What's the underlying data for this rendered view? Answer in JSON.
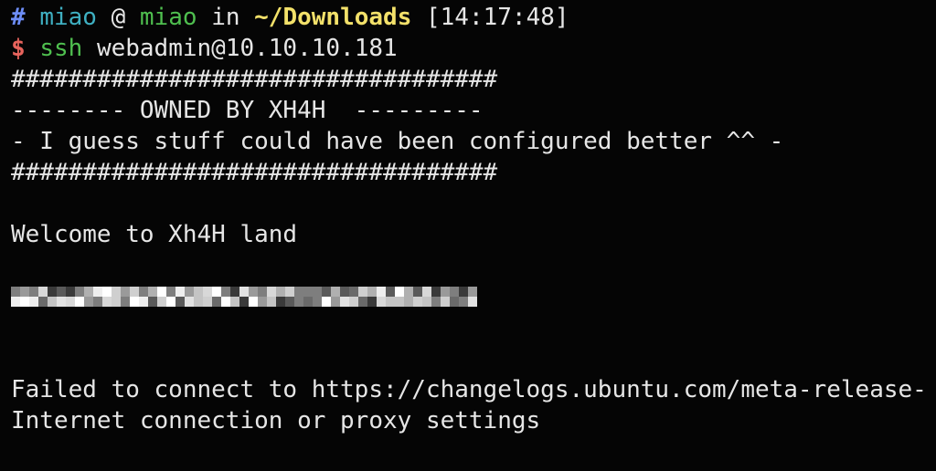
{
  "prompt": {
    "hash": "#",
    "user": "miao",
    "at": "@",
    "host": "miao",
    "in": "in",
    "path": "~/Downloads",
    "time": "[14:17:48]"
  },
  "command": {
    "dollar": "$",
    "program": "ssh",
    "args": "webadmin@10.10.10.181"
  },
  "output": {
    "banner_top": "##################################",
    "owned_line": "-------- OWNED BY XH4H  ---------",
    "guess_line": "- I guess stuff could have been configured better ^^ -",
    "banner_bottom": "##################################",
    "welcome": "Welcome to Xh4H land",
    "failed": "Failed to connect to https://changelogs.ubuntu.com/meta-release-",
    "internet": "Internet connection or proxy settings"
  },
  "colors": {
    "background": "#050505",
    "text": "#e6e6e6",
    "hash": "#6d8df7",
    "user": "#3fb0c2",
    "host": "#4fbf4f",
    "path": "#f3e16a",
    "dollar": "#e8645d"
  }
}
